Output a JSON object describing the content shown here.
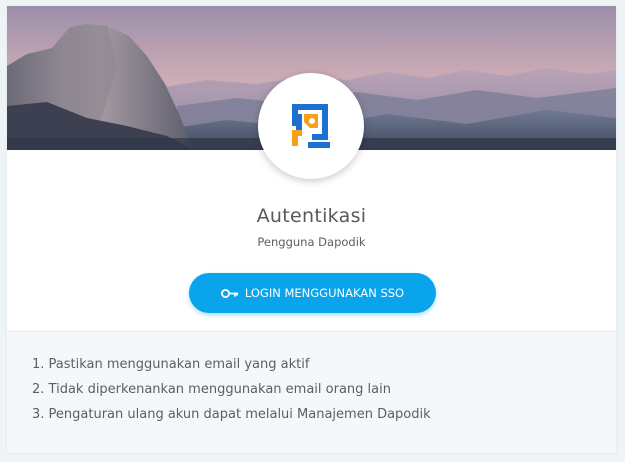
{
  "header": {
    "banner_image": "mountain-landscape",
    "logo": "dapodik-logo",
    "logo_colors": {
      "blue": "#1d6fd0",
      "orange": "#f5a01a"
    }
  },
  "auth": {
    "title": "Autentikasi",
    "subtitle": "Pengguna Dapodik"
  },
  "sso_button": {
    "label": "LOGIN MENGGUNAKAN SSO",
    "icon": "key-icon",
    "color": "#0aa4ec"
  },
  "notes": {
    "items": [
      "1. Pastikan menggunakan email yang aktif",
      "2. Tidak diperkenankan menggunakan email orang lain",
      "3. Pengaturan ulang akun dapat melalui Manajemen Dapodik"
    ]
  }
}
